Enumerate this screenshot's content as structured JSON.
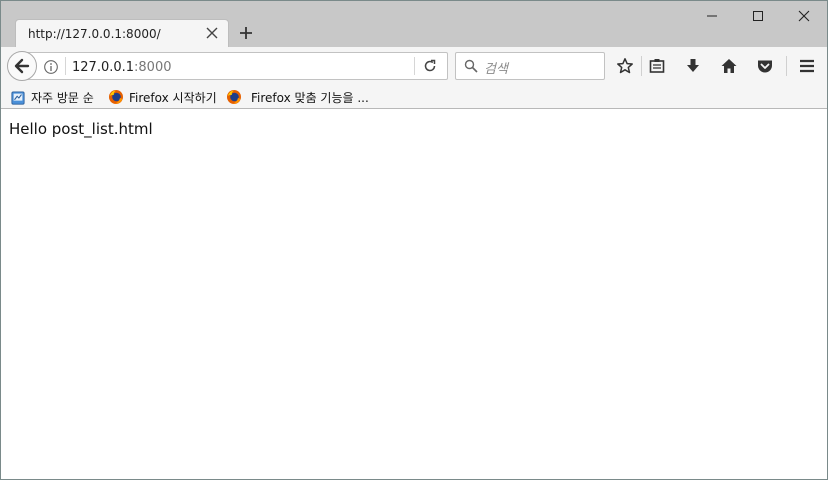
{
  "browser": {
    "tab": {
      "title": "http://127.0.0.1:8000/"
    },
    "url": {
      "host": "127.0.0.1",
      "port": ":8000"
    },
    "search": {
      "placeholder": "검색"
    },
    "icons": {
      "back": "back-arrow-icon",
      "info": "info-icon",
      "reload": "reload-icon",
      "search": "search-icon",
      "bookmark_star": "star-icon",
      "reading_list": "clipboard-icon",
      "downloads": "download-icon",
      "home": "home-icon",
      "pocket": "pocket-icon",
      "menu": "hamburger-icon",
      "tab_close": "close-icon",
      "new_tab": "plus-icon",
      "minimize": "minimize-icon",
      "maximize": "maximize-icon",
      "window_close": "close-icon"
    },
    "bookmarks": [
      {
        "label": "자주 방문 순",
        "icon": "most-visited-icon"
      },
      {
        "label": "Firefox 시작하기",
        "icon": "firefox-logo-icon"
      },
      {
        "label": "Firefox 맞춤 기능을 ...",
        "icon": "firefox-logo-icon"
      }
    ]
  },
  "page": {
    "body_text": "Hello post_list.html"
  },
  "colors": {
    "titlebar": "#c8c8c8",
    "toolbar": "#f5f5f5",
    "tab_active": "#f5f5f5",
    "icon": "#333333",
    "border": "#c2c2c2"
  }
}
